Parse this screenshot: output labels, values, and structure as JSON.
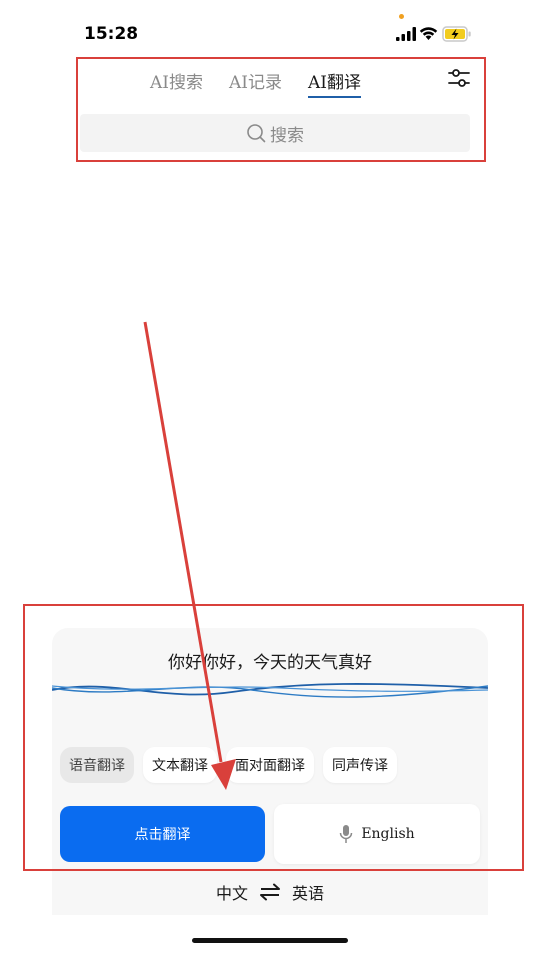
{
  "status_bar": {
    "time": "15:28"
  },
  "header": {
    "tabs": [
      {
        "label": "AI搜索",
        "active": false
      },
      {
        "label": "AI记录",
        "active": false
      },
      {
        "label": "AI翻译",
        "active": true
      }
    ],
    "filter_icon": "sliders-icon"
  },
  "search": {
    "label": "搜索",
    "icon": "search-icon"
  },
  "translation": {
    "recognized_text": "你好你好，今天的天气真好",
    "modes": [
      {
        "label": "语音翻译",
        "selected": true
      },
      {
        "label": "文本翻译",
        "selected": false
      },
      {
        "label": "面对面翻译",
        "selected": false
      },
      {
        "label": "同声传译",
        "selected": false
      }
    ],
    "primary_button": "点击翻译",
    "voice_button": "English",
    "source_language": "中文",
    "target_language": "英语"
  },
  "colors": {
    "accent": "#0a6cf0",
    "annotation": "#d9403b",
    "tab_underline": "#1f5fa8"
  }
}
